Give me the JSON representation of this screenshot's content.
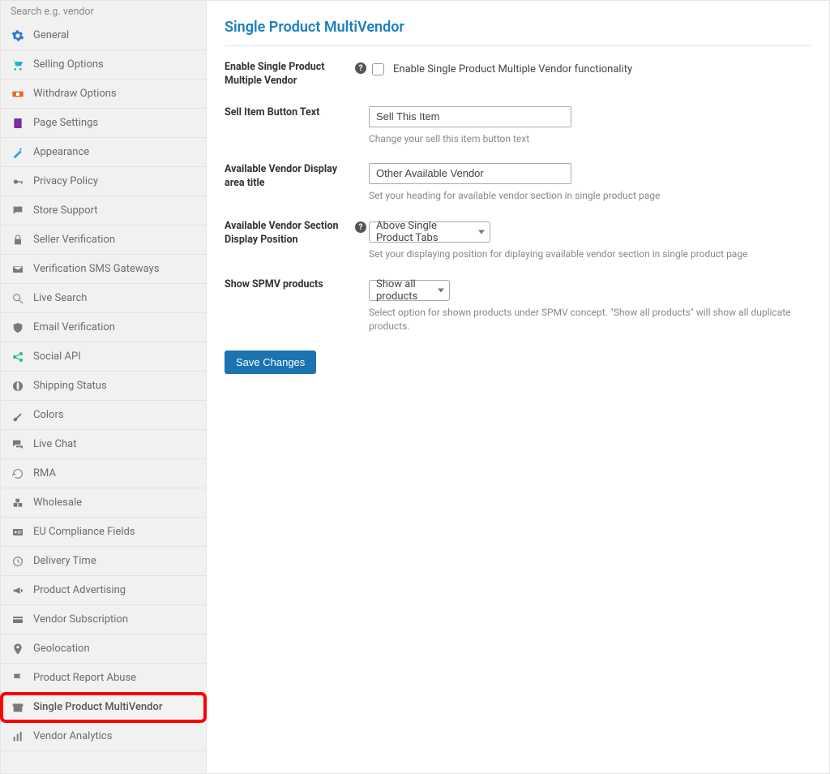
{
  "sidebar": {
    "search_placeholder": "Search e.g. vendor",
    "active_index": 22,
    "items": [
      {
        "label": "General"
      },
      {
        "label": "Selling Options"
      },
      {
        "label": "Withdraw Options"
      },
      {
        "label": "Page Settings"
      },
      {
        "label": "Appearance"
      },
      {
        "label": "Privacy Policy"
      },
      {
        "label": "Store Support"
      },
      {
        "label": "Seller Verification"
      },
      {
        "label": "Verification SMS Gateways"
      },
      {
        "label": "Live Search"
      },
      {
        "label": "Email Verification"
      },
      {
        "label": "Social API"
      },
      {
        "label": "Shipping Status"
      },
      {
        "label": "Colors"
      },
      {
        "label": "Live Chat"
      },
      {
        "label": "RMA"
      },
      {
        "label": "Wholesale"
      },
      {
        "label": "EU Compliance Fields"
      },
      {
        "label": "Delivery Time"
      },
      {
        "label": "Product Advertising"
      },
      {
        "label": "Vendor Subscription"
      },
      {
        "label": "Geolocation"
      },
      {
        "label": "Product Report Abuse"
      },
      {
        "label": "Single Product MultiVendor"
      },
      {
        "label": "Vendor Analytics"
      }
    ]
  },
  "main": {
    "title": "Single Product MultiVendor",
    "enable": {
      "label": "Enable Single Product Multiple Vendor",
      "checkbox_label": "Enable Single Product Multiple Vendor functionality"
    },
    "sell_button": {
      "label": "Sell Item Button Text",
      "value": "Sell This Item",
      "desc": "Change your sell this item button text"
    },
    "vendor_title": {
      "label": "Available Vendor Display area title",
      "value": "Other Available Vendor",
      "desc": "Set your heading for available vendor section in single product page"
    },
    "position": {
      "label": "Available Vendor Section Display Position",
      "value": "Above Single Product Tabs",
      "desc": "Set your displaying position for diplaying available vendor section in single product page"
    },
    "show_spmv": {
      "label": "Show SPMV products",
      "value": "Show all products",
      "desc": "Select option for shown products under SPMV concept. \"Show all products\" will show all duplicate products."
    },
    "save_button": "Save Changes"
  }
}
